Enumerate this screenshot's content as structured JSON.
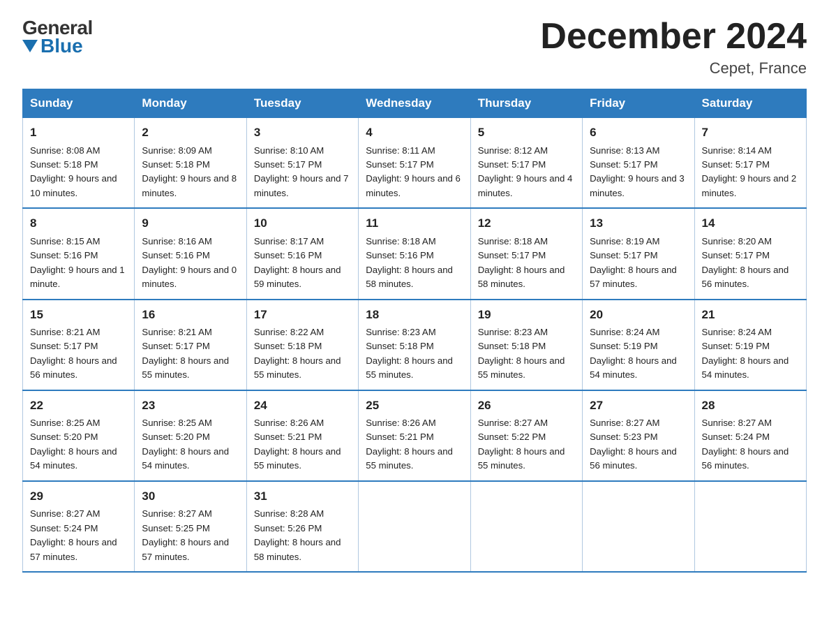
{
  "header": {
    "title": "December 2024",
    "subtitle": "Cepet, France",
    "logo_general": "General",
    "logo_blue": "Blue"
  },
  "days_of_week": [
    "Sunday",
    "Monday",
    "Tuesday",
    "Wednesday",
    "Thursday",
    "Friday",
    "Saturday"
  ],
  "weeks": [
    [
      {
        "num": "1",
        "sunrise": "8:08 AM",
        "sunset": "5:18 PM",
        "daylight": "9 hours and 10 minutes."
      },
      {
        "num": "2",
        "sunrise": "8:09 AM",
        "sunset": "5:18 PM",
        "daylight": "9 hours and 8 minutes."
      },
      {
        "num": "3",
        "sunrise": "8:10 AM",
        "sunset": "5:17 PM",
        "daylight": "9 hours and 7 minutes."
      },
      {
        "num": "4",
        "sunrise": "8:11 AM",
        "sunset": "5:17 PM",
        "daylight": "9 hours and 6 minutes."
      },
      {
        "num": "5",
        "sunrise": "8:12 AM",
        "sunset": "5:17 PM",
        "daylight": "9 hours and 4 minutes."
      },
      {
        "num": "6",
        "sunrise": "8:13 AM",
        "sunset": "5:17 PM",
        "daylight": "9 hours and 3 minutes."
      },
      {
        "num": "7",
        "sunrise": "8:14 AM",
        "sunset": "5:17 PM",
        "daylight": "9 hours and 2 minutes."
      }
    ],
    [
      {
        "num": "8",
        "sunrise": "8:15 AM",
        "sunset": "5:16 PM",
        "daylight": "9 hours and 1 minute."
      },
      {
        "num": "9",
        "sunrise": "8:16 AM",
        "sunset": "5:16 PM",
        "daylight": "9 hours and 0 minutes."
      },
      {
        "num": "10",
        "sunrise": "8:17 AM",
        "sunset": "5:16 PM",
        "daylight": "8 hours and 59 minutes."
      },
      {
        "num": "11",
        "sunrise": "8:18 AM",
        "sunset": "5:16 PM",
        "daylight": "8 hours and 58 minutes."
      },
      {
        "num": "12",
        "sunrise": "8:18 AM",
        "sunset": "5:17 PM",
        "daylight": "8 hours and 58 minutes."
      },
      {
        "num": "13",
        "sunrise": "8:19 AM",
        "sunset": "5:17 PM",
        "daylight": "8 hours and 57 minutes."
      },
      {
        "num": "14",
        "sunrise": "8:20 AM",
        "sunset": "5:17 PM",
        "daylight": "8 hours and 56 minutes."
      }
    ],
    [
      {
        "num": "15",
        "sunrise": "8:21 AM",
        "sunset": "5:17 PM",
        "daylight": "8 hours and 56 minutes."
      },
      {
        "num": "16",
        "sunrise": "8:21 AM",
        "sunset": "5:17 PM",
        "daylight": "8 hours and 55 minutes."
      },
      {
        "num": "17",
        "sunrise": "8:22 AM",
        "sunset": "5:18 PM",
        "daylight": "8 hours and 55 minutes."
      },
      {
        "num": "18",
        "sunrise": "8:23 AM",
        "sunset": "5:18 PM",
        "daylight": "8 hours and 55 minutes."
      },
      {
        "num": "19",
        "sunrise": "8:23 AM",
        "sunset": "5:18 PM",
        "daylight": "8 hours and 55 minutes."
      },
      {
        "num": "20",
        "sunrise": "8:24 AM",
        "sunset": "5:19 PM",
        "daylight": "8 hours and 54 minutes."
      },
      {
        "num": "21",
        "sunrise": "8:24 AM",
        "sunset": "5:19 PM",
        "daylight": "8 hours and 54 minutes."
      }
    ],
    [
      {
        "num": "22",
        "sunrise": "8:25 AM",
        "sunset": "5:20 PM",
        "daylight": "8 hours and 54 minutes."
      },
      {
        "num": "23",
        "sunrise": "8:25 AM",
        "sunset": "5:20 PM",
        "daylight": "8 hours and 54 minutes."
      },
      {
        "num": "24",
        "sunrise": "8:26 AM",
        "sunset": "5:21 PM",
        "daylight": "8 hours and 55 minutes."
      },
      {
        "num": "25",
        "sunrise": "8:26 AM",
        "sunset": "5:21 PM",
        "daylight": "8 hours and 55 minutes."
      },
      {
        "num": "26",
        "sunrise": "8:27 AM",
        "sunset": "5:22 PM",
        "daylight": "8 hours and 55 minutes."
      },
      {
        "num": "27",
        "sunrise": "8:27 AM",
        "sunset": "5:23 PM",
        "daylight": "8 hours and 56 minutes."
      },
      {
        "num": "28",
        "sunrise": "8:27 AM",
        "sunset": "5:24 PM",
        "daylight": "8 hours and 56 minutes."
      }
    ],
    [
      {
        "num": "29",
        "sunrise": "8:27 AM",
        "sunset": "5:24 PM",
        "daylight": "8 hours and 57 minutes."
      },
      {
        "num": "30",
        "sunrise": "8:27 AM",
        "sunset": "5:25 PM",
        "daylight": "8 hours and 57 minutes."
      },
      {
        "num": "31",
        "sunrise": "8:28 AM",
        "sunset": "5:26 PM",
        "daylight": "8 hours and 58 minutes."
      },
      null,
      null,
      null,
      null
    ]
  ]
}
